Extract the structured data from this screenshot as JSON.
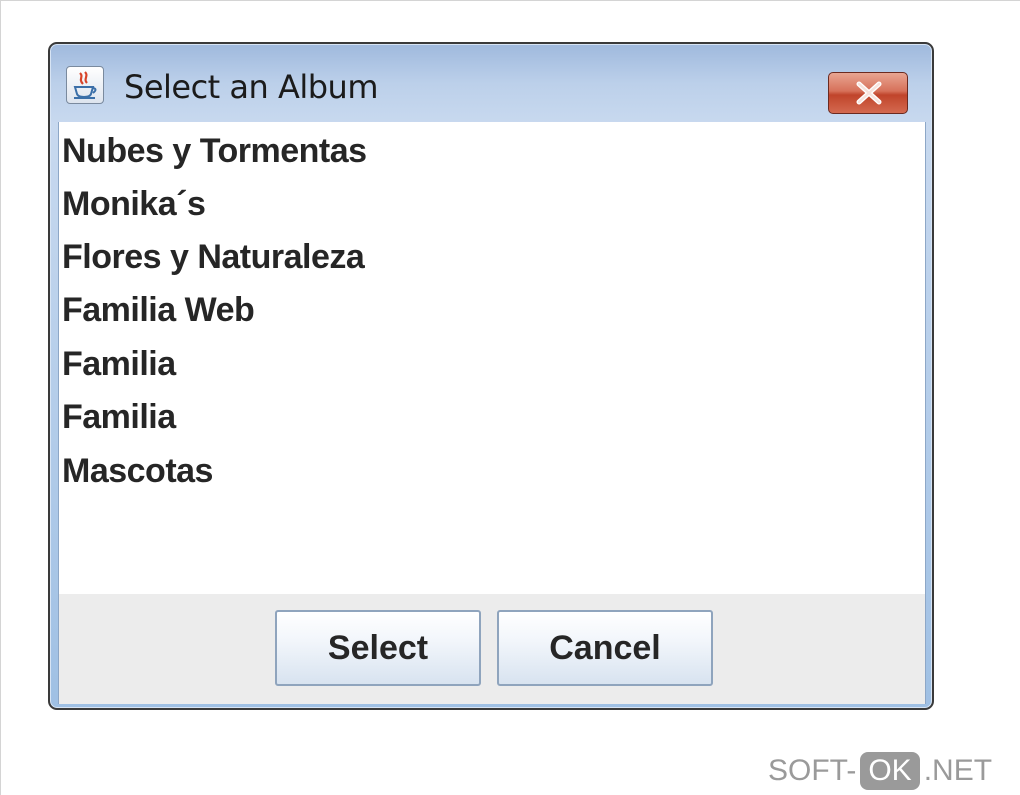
{
  "window": {
    "title": "Select an Album",
    "close_icon": "close-x-icon",
    "app_icon": "java-coffee-icon"
  },
  "albums": [
    "Nubes y Tormentas",
    "Monika´s",
    "Flores y Naturaleza",
    "Familia Web",
    "Familia",
    "Familia",
    "Mascotas"
  ],
  "buttons": {
    "select_label": "Select",
    "cancel_label": "Cancel"
  },
  "watermark": {
    "left": "SOFT-",
    "badge": "OK",
    "right": ".NET"
  },
  "colors": {
    "titlebar": "#bcd0ea",
    "close_button": "#c0442b",
    "button_bar": "#ececec"
  }
}
